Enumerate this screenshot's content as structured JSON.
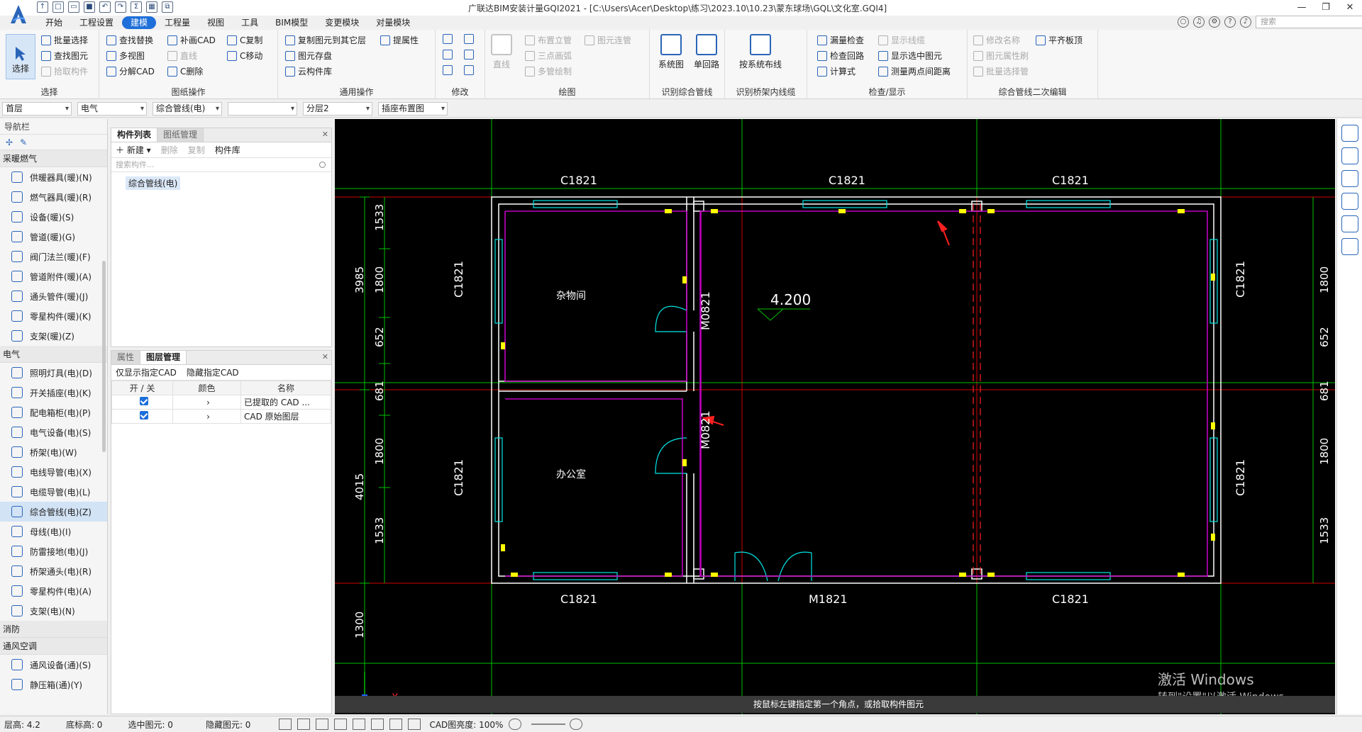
{
  "title_bar": {
    "title": "广联达BIM安装计量GQI2021 - [C:\\Users\\Acer\\Desktop\\练习\\2023.10\\10.23\\蒙东球场\\GQL\\文化室.GQI4]",
    "search_placeholder": "搜索"
  },
  "menu": {
    "tabs": [
      "开始",
      "工程设置",
      "建模",
      "工程量",
      "视图",
      "工具",
      "BIM模型",
      "变更模块",
      "对量模块"
    ],
    "active": "建模"
  },
  "ribbon": {
    "select_group": {
      "title": "选择",
      "big": "选择",
      "items": [
        "批量选择",
        "查找图元",
        "拾取构件"
      ]
    },
    "drawing_group": {
      "title": "图纸操作",
      "items": [
        "查找替换",
        "多视图",
        "分解CAD",
        "补画CAD",
        "直线",
        "C删除",
        "C复制",
        "C移动"
      ]
    },
    "general_group": {
      "title": "通用操作",
      "items": [
        "复制图元到其它层",
        "提属性",
        "图元存盘",
        "云构件库"
      ]
    },
    "modify_group": {
      "title": "修改"
    },
    "draw_group": {
      "title": "绘图",
      "items": [
        "直线",
        "布置立管",
        "图元连管",
        "三点画弧",
        "多管绘制"
      ]
    },
    "identify_group": {
      "title": "识别综合管线",
      "items": [
        "系统图",
        "单回路"
      ]
    },
    "tray_group": {
      "title": "识别桥架内线缆",
      "items": [
        "按系统布线"
      ]
    },
    "check_group": {
      "title": "检查/显示",
      "items": [
        "漏量检查",
        "显示线缆",
        "检查回路",
        "显示选中图元",
        "计算式",
        "测量两点间距离"
      ]
    },
    "edit2_group": {
      "title": "综合管线二次编辑",
      "items": [
        "修改名称",
        "平齐板顶",
        "图元属性刷",
        "批量选择管"
      ]
    }
  },
  "dropdowns": [
    "首层",
    "电气",
    "综合管线(电)",
    "",
    "分层2",
    "插座布置图"
  ],
  "nav": {
    "header": "导航栏",
    "categories": [
      {
        "name": "采暖燃气",
        "items": [
          "供暖器具(暖)(N)",
          "燃气器具(暖)(R)",
          "设备(暖)(S)",
          "管道(暖)(G)",
          "阀门法兰(暖)(F)",
          "管道附件(暖)(A)",
          "通头管件(暖)(J)",
          "零星构件(暖)(K)",
          "支架(暖)(Z)"
        ]
      },
      {
        "name": "电气",
        "items": [
          "照明灯具(电)(D)",
          "开关插座(电)(K)",
          "配电箱柜(电)(P)",
          "电气设备(电)(S)",
          "桥架(电)(W)",
          "电线导管(电)(X)",
          "电缆导管(电)(L)",
          "综合管线(电)(Z)",
          "母线(电)(I)",
          "防雷接地(电)(J)",
          "桥架通头(电)(R)",
          "零星构件(电)(A)",
          "支架(电)(N)"
        ]
      },
      {
        "name": "消防",
        "items": []
      },
      {
        "name": "通风空调",
        "items": [
          "通风设备(通)(S)",
          "静压箱(通)(Y)"
        ]
      }
    ],
    "active_item": "综合管线(电)(Z)"
  },
  "component_panel": {
    "tabs": [
      "构件列表",
      "图纸管理"
    ],
    "toolbar": [
      "新建",
      "删除",
      "复制",
      "构件库"
    ],
    "search_placeholder": "搜索构件...",
    "items": [
      "综合管线(电)"
    ]
  },
  "layer_panel": {
    "tabs": [
      "属性",
      "图层管理"
    ],
    "toolbar": [
      "仅显示指定CAD",
      "隐藏指定CAD"
    ],
    "columns": [
      "开 / 关",
      "颜色",
      "名称"
    ],
    "rows": [
      {
        "on": true,
        "name": "已提取的 CAD ..."
      },
      {
        "on": true,
        "name": "CAD 原始图层"
      }
    ]
  },
  "cad": {
    "labels_top": [
      "C1821",
      "C1821",
      "C1821"
    ],
    "labels_bottom": [
      "C1821",
      "M1821",
      "C1821"
    ],
    "labels_side": [
      "C1821",
      "C1821",
      "C1821",
      "C1821"
    ],
    "doors": [
      "M0821",
      "M0821"
    ],
    "rooms": [
      "杂物间",
      "办公室"
    ],
    "elevation": "4.200",
    "dims_left_outer": [
      "3985",
      "4015",
      "1300"
    ],
    "dims_left_inner": [
      "1533",
      "1800",
      "652",
      "681",
      "1800",
      "1533"
    ],
    "dims_right": [
      "1800",
      "652",
      "681",
      "1800",
      "1533"
    ],
    "axis_x": "X",
    "colors": {
      "wall": "#ffffff",
      "axis": "#ff0000",
      "dim": "#00c800",
      "window": "#00e5e5",
      "pipe": "#c000c0",
      "socket": "#ffff00"
    }
  },
  "watermark": {
    "line1": "激活 Windows",
    "line2": "转到\"设置\"以激活 Windows。"
  },
  "hint": "按鼠标左键指定第一个角点，或拾取构件图元",
  "status": {
    "layer_height": "层高: 4.2",
    "bottom_elev": "底标高: 0",
    "selected": "选中图元: 0",
    "hidden": "隐藏图元: 0",
    "cad_brightness": "CAD图亮度: 100%"
  }
}
